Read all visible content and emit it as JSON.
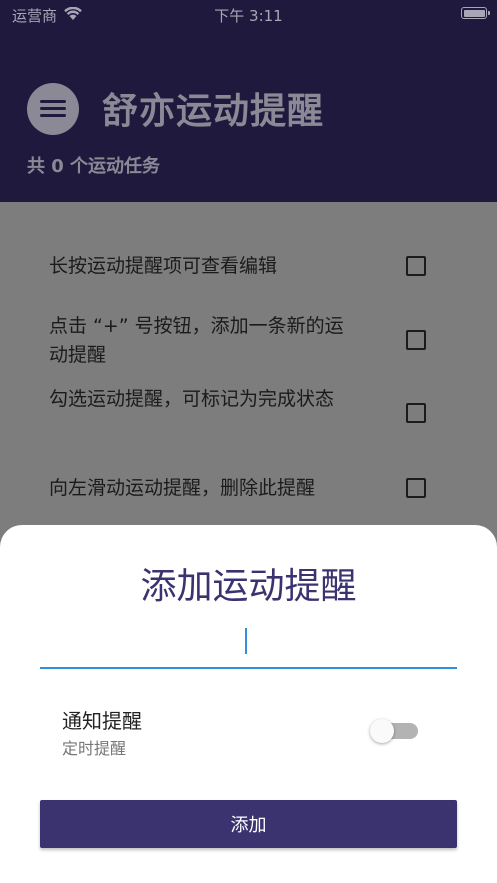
{
  "status_bar": {
    "carrier": "运营商",
    "time": "下午 3:11"
  },
  "header": {
    "title": "舒亦运动提醒",
    "task_count": "共 0 个运动任务"
  },
  "list": {
    "items": [
      {
        "text": "长按运动提醒项可查看编辑",
        "checked": false
      },
      {
        "text": "点击 “+” 号按钮，添加一条新的运动提醒",
        "checked": false
      },
      {
        "text": "勾选运动提醒，可标记为完成状态",
        "checked": false
      },
      {
        "text": "向左滑动运动提醒，删除此提醒",
        "checked": false
      }
    ]
  },
  "sheet": {
    "title": "添加运动提醒",
    "input_value": "",
    "notify_title": "通知提醒",
    "notify_subtitle": "定时提醒",
    "notify_enabled": false,
    "add_label": "添加"
  },
  "colors": {
    "header_bg": "#1f1a3d",
    "accent": "#3b3370",
    "input_underline": "#2f8fe0"
  }
}
